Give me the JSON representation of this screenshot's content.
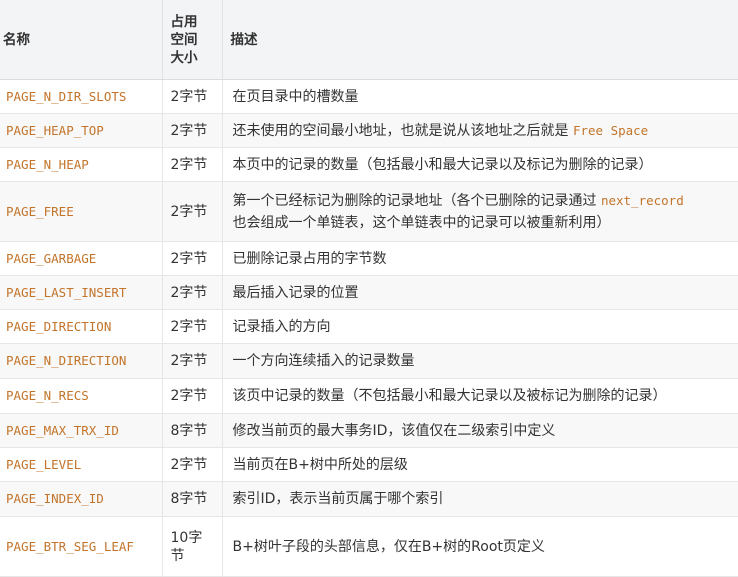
{
  "table": {
    "headers": {
      "name": "名称",
      "size_line1": "占用",
      "size_line2": "空间",
      "size_line3": "大小",
      "desc": "描述"
    },
    "rows": [
      {
        "name": "PAGE_N_DIR_SLOTS",
        "size": "2字节",
        "desc": "在页目录中的槽数量"
      },
      {
        "name": "PAGE_HEAP_TOP",
        "size": "2字节",
        "desc_pre": "还未使用的空间最小地址，也就是说从该地址之后就是",
        "desc_code": "Free Space"
      },
      {
        "name": "PAGE_N_HEAP",
        "size": "2字节",
        "desc": "本页中的记录的数量（包括最小和最大记录以及标记为删除的记录）"
      },
      {
        "name": "PAGE_FREE",
        "size": "2字节",
        "desc_pre": "第一个已经标记为删除的记录地址（各个已删除的记录通过",
        "desc_code": "next_record",
        "desc_post": "也会组成一个单链表，这个单链表中的记录可以被重新利用）"
      },
      {
        "name": "PAGE_GARBAGE",
        "size": "2字节",
        "desc": "已删除记录占用的字节数"
      },
      {
        "name": "PAGE_LAST_INSERT",
        "size": "2字节",
        "desc": "最后插入记录的位置"
      },
      {
        "name": "PAGE_DIRECTION",
        "size": "2字节",
        "desc": "记录插入的方向"
      },
      {
        "name": "PAGE_N_DIRECTION",
        "size": "2字节",
        "desc": "一个方向连续插入的记录数量"
      },
      {
        "name": "PAGE_N_RECS",
        "size": "2字节",
        "desc": "该页中记录的数量（不包括最小和最大记录以及被标记为删除的记录）"
      },
      {
        "name": "PAGE_MAX_TRX_ID",
        "size": "8字节",
        "desc": "修改当前页的最大事务ID，该值仅在二级索引中定义"
      },
      {
        "name": "PAGE_LEVEL",
        "size": "2字节",
        "desc": "当前页在B+树中所处的层级"
      },
      {
        "name": "PAGE_INDEX_ID",
        "size": "8字节",
        "desc": "索引ID，表示当前页属于哪个索引"
      },
      {
        "name": "PAGE_BTR_SEG_LEAF",
        "size_line1": "10字",
        "size_line2": "节",
        "desc": "B+树叶子段的头部信息，仅在B+树的Root页定义"
      }
    ]
  }
}
